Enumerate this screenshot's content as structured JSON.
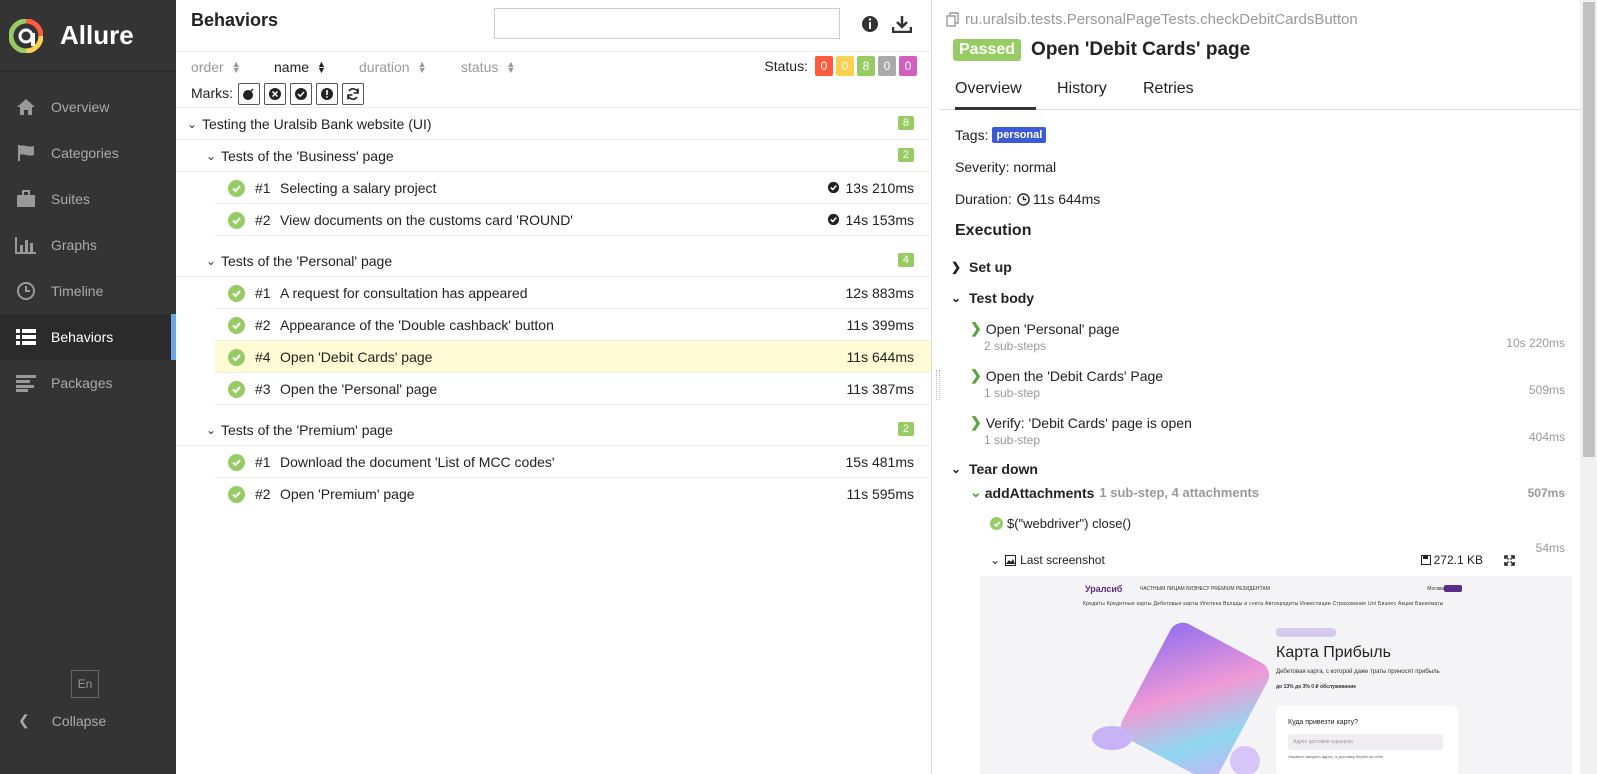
{
  "app": {
    "name": "Allure"
  },
  "sidebar": {
    "items": [
      {
        "label": "Overview",
        "icon": "home-icon"
      },
      {
        "label": "Categories",
        "icon": "flag-icon"
      },
      {
        "label": "Suites",
        "icon": "briefcase-icon"
      },
      {
        "label": "Graphs",
        "icon": "bar-chart-icon"
      },
      {
        "label": "Timeline",
        "icon": "clock-icon"
      },
      {
        "label": "Behaviors",
        "icon": "list-icon",
        "active": true
      },
      {
        "label": "Packages",
        "icon": "align-left-icon"
      }
    ],
    "language": "En",
    "collapse": "Collapse"
  },
  "tree": {
    "title": "Behaviors",
    "search_placeholder": "",
    "sort": [
      {
        "label": "order"
      },
      {
        "label": "name",
        "active": true
      },
      {
        "label": "duration"
      },
      {
        "label": "status"
      }
    ],
    "status_label": "Status:",
    "status_counts": [
      {
        "value": "0",
        "color": "#fd5a3e"
      },
      {
        "value": "0",
        "color": "#ffd050"
      },
      {
        "value": "8",
        "color": "#97cc64"
      },
      {
        "value": "0",
        "color": "#aaaaaa"
      },
      {
        "value": "0",
        "color": "#d35ebe"
      }
    ],
    "marks_label": "Marks:",
    "root": {
      "name": "Testing the Uralsib Bank website (UI)",
      "count": "8"
    },
    "groups": [
      {
        "name": "Tests of the 'Business' page",
        "count": "2",
        "tests": [
          {
            "num": "#1",
            "name": "Selecting a salary project",
            "duration": "13s 210ms",
            "flaky": true
          },
          {
            "num": "#2",
            "name": "View documents on the customs card 'ROUND'",
            "duration": "14s 153ms",
            "flaky": true
          }
        ]
      },
      {
        "name": "Tests of the 'Personal' page",
        "count": "4",
        "tests": [
          {
            "num": "#1",
            "name": "A request for consultation has appeared",
            "duration": "12s 883ms"
          },
          {
            "num": "#2",
            "name": "Appearance of the 'Double cashback' button",
            "duration": "11s 399ms"
          },
          {
            "num": "#4",
            "name": "Open 'Debit Cards' page",
            "duration": "11s 644ms",
            "selected": true
          },
          {
            "num": "#3",
            "name": "Open the 'Personal' page",
            "duration": "11s 387ms"
          }
        ]
      },
      {
        "name": "Tests of the 'Premium' page",
        "count": "2",
        "tests": [
          {
            "num": "#1",
            "name": "Download the document 'List of MCC codes'",
            "duration": "15s 481ms"
          },
          {
            "num": "#2",
            "name": "Open 'Premium' page",
            "duration": "11s 595ms"
          }
        ]
      }
    ]
  },
  "details": {
    "full_name": "ru.uralsib.tests.PersonalPageTests.checkDebitCardsButton",
    "status": "Passed",
    "title": "Open 'Debit Cards' page",
    "tabs": [
      "Overview",
      "History",
      "Retries"
    ],
    "tags_label": "Tags:",
    "tag": "personal",
    "severity": "Severity: normal",
    "duration_label": "Duration:",
    "duration": "11s 644ms",
    "execution_title": "Execution",
    "setup": "Set up",
    "test_body": "Test body",
    "steps": [
      {
        "name": "Open 'Personal' page",
        "sub": "2 sub-steps",
        "duration": "10s 220ms"
      },
      {
        "name": "Open the 'Debit Cards' Page",
        "sub": "1 sub-step",
        "duration": "509ms"
      },
      {
        "name": "Verify: 'Debit Cards' page is open",
        "sub": "1 sub-step",
        "duration": "404ms"
      }
    ],
    "teardown": "Tear down",
    "add_attachments": {
      "name": "addAttachments",
      "meta": "1 sub-step, 4 attachments",
      "duration": "507ms"
    },
    "close_step": {
      "name": "$(\"webdriver\") close()",
      "duration": "54ms"
    },
    "attachment": {
      "name": "Last screenshot",
      "size": "272.1 KB"
    },
    "screenshot": {
      "logo": "Уралсиб",
      "nav": "ЧАСТНЫМ ЛИЦАМ   БИЗНЕСУ   PREMIUM   РЕЗИДЕНТАМ",
      "nav2": "Кредиты   Кредитные карты   Дебетовые карты   Ипотека   Вклады и счета   Автокредиты   Инвестиции   Страхование   Uni Бизнес   Акции   Банкоматы",
      "top_right": "Москва   Вход",
      "heading": "Карта Прибыль",
      "subtitle": "Дебетовая карта, с которой даже траты приносят прибыль",
      "features": "до 13%   до 3%   0 ₽ обслуживание",
      "question": "Куда привезти карту?",
      "input": "Адрес доставки курьером",
      "hint": "Нажмите вводить адрес, а доставку берём на себя"
    }
  }
}
